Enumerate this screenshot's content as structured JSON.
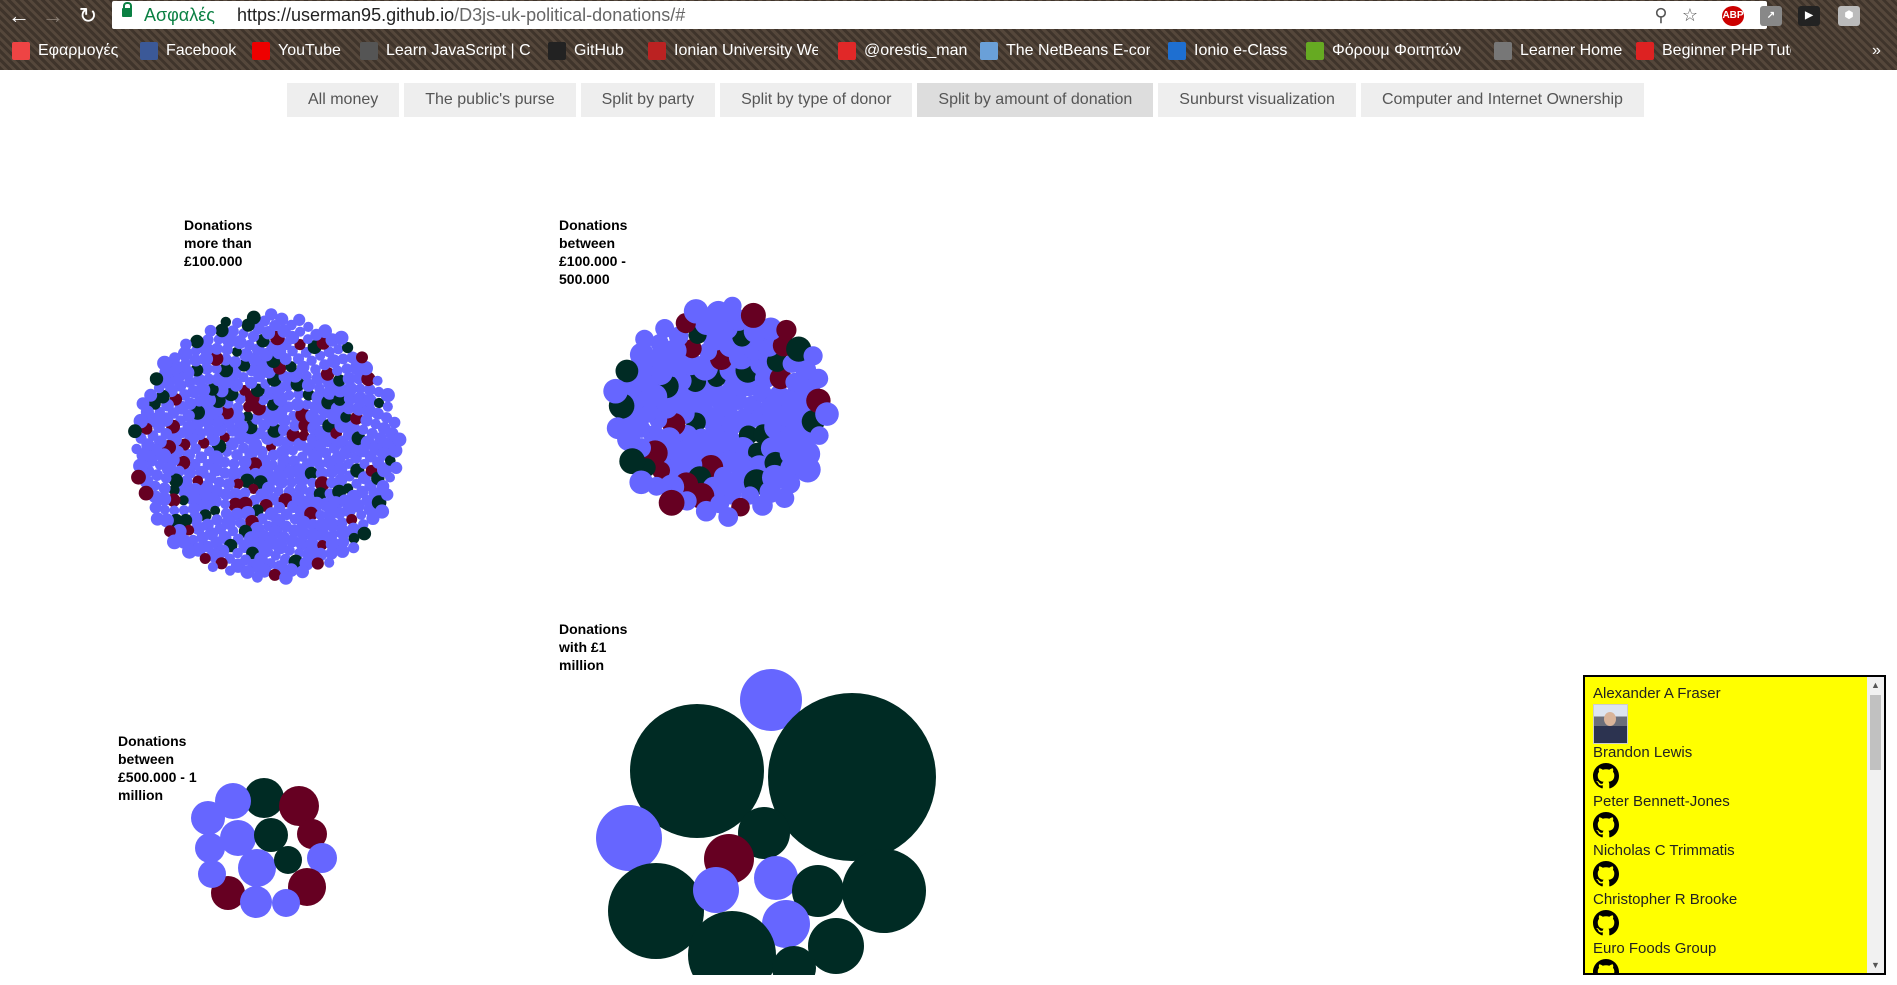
{
  "browser": {
    "secure_label": "Ασφαλές",
    "url_host": "https://userman95.github.io",
    "url_path": "/D3js-uk-political-donations/#",
    "bookmarks": [
      {
        "label": "Εφαρμογές",
        "icon": "apps-icon",
        "color": "#e44"
      },
      {
        "label": "Facebook",
        "icon": "facebook-icon",
        "color": "#3b5998"
      },
      {
        "label": "YouTube",
        "icon": "youtube-icon",
        "color": "#e00"
      },
      {
        "label": "Learn JavaScript | Co",
        "icon": "codecademy-icon",
        "color": "#555"
      },
      {
        "label": "GitHub",
        "icon": "github-icon",
        "color": "#222"
      },
      {
        "label": "Ionian University We",
        "icon": "ionian-icon",
        "color": "#b22"
      },
      {
        "label": "@orestis_man",
        "icon": "flipboard-icon",
        "color": "#e12828"
      },
      {
        "label": "The NetBeans E-com",
        "icon": "netbeans-icon",
        "color": "#6aa0d8"
      },
      {
        "label": "Ionio e-Class",
        "icon": "eclass-icon",
        "color": "#1e6fd1"
      },
      {
        "label": "Φόρουμ Φοιτητών",
        "icon": "forum-icon",
        "color": "#6a2"
      },
      {
        "label": "Learner Home",
        "icon": "page-icon",
        "color": "#777"
      },
      {
        "label": "Beginner PHP Tutor",
        "icon": "php-icon",
        "color": "#d22"
      }
    ],
    "more": "»"
  },
  "tabs": [
    {
      "label": "All money",
      "active": false
    },
    {
      "label": "The public's purse",
      "active": false
    },
    {
      "label": "Split by party",
      "active": false
    },
    {
      "label": "Split by type of donor",
      "active": false
    },
    {
      "label": "Split by amount of donation",
      "active": true
    },
    {
      "label": "Sunburst visualization",
      "active": false
    },
    {
      "label": "Computer and Internet Ownership",
      "active": false
    }
  ],
  "colors": {
    "blue": "#6666ff",
    "dark_green": "#002b24",
    "dark_red": "#660022",
    "panel": "#ffff00"
  },
  "charts": [
    {
      "title_lines": [
        "Donations",
        "more than",
        "£100.000"
      ]
    },
    {
      "title_lines": [
        "Donations",
        "between",
        "£100.000 -",
        "500.000"
      ]
    },
    {
      "title_lines": [
        "Donations",
        "between",
        "£500.000 - 1",
        "million"
      ]
    },
    {
      "title_lines": [
        "Donations",
        "with £1",
        "million"
      ]
    }
  ],
  "panel": {
    "entries": [
      {
        "name": "Alexander A Fraser",
        "image": "photo"
      },
      {
        "name": "Brandon Lewis",
        "image": "github-icon"
      },
      {
        "name": "Peter Bennett-Jones",
        "image": "github-icon"
      },
      {
        "name": "Nicholas C Trimmatis",
        "image": "github-icon"
      },
      {
        "name": "Christopher R Brooke",
        "image": "github-icon"
      },
      {
        "name": "Euro Foods Group",
        "image": "github-icon"
      }
    ]
  }
}
